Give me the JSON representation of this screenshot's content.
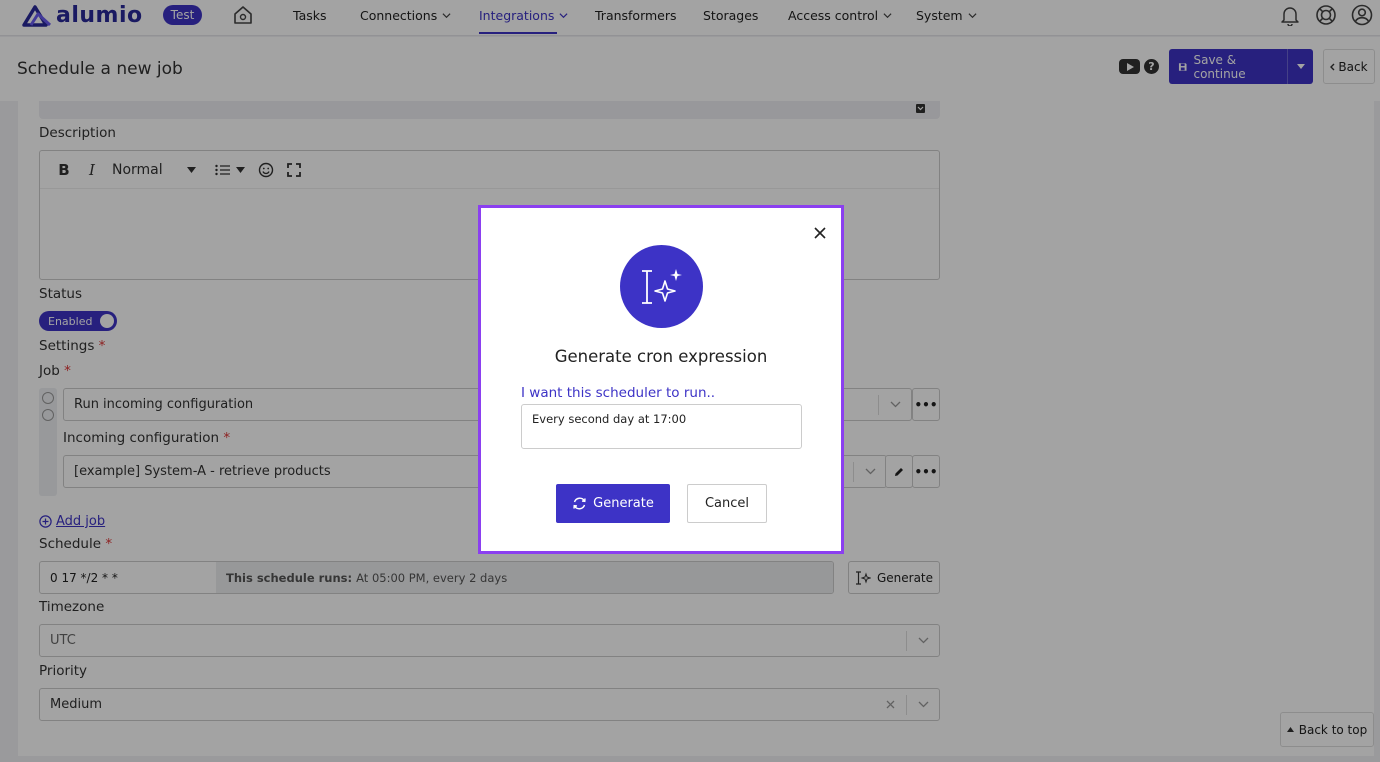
{
  "brand": {
    "name": "alumio",
    "env_badge": "Test"
  },
  "nav": {
    "items": [
      {
        "label": "Tasks"
      },
      {
        "label": "Connections"
      },
      {
        "label": "Integrations"
      },
      {
        "label": "Transformers"
      },
      {
        "label": "Storages"
      },
      {
        "label": "Access control"
      },
      {
        "label": "System"
      }
    ],
    "active": "Integrations"
  },
  "header": {
    "title": "Schedule a new job",
    "save_label": "Save & continue",
    "back_label": "Back",
    "help_glyph": "?"
  },
  "form": {
    "description_label": "Description",
    "editor": {
      "bold": "B",
      "italic": "I",
      "heading_select": "Normal"
    },
    "status_label": "Status",
    "status_toggle": "Enabled",
    "settings_label": "Settings",
    "job_label": "Job",
    "job_value": "Run incoming configuration",
    "incoming_label": "Incoming configuration",
    "incoming_value": "[example] System-A - retrieve products",
    "add_job": "Add job",
    "schedule_label": "Schedule",
    "schedule_expr": "0 17 */2 * *",
    "schedule_desc_prefix": "This schedule runs:",
    "schedule_desc": "At 05:00 PM, every 2 days",
    "generate_label": "Generate",
    "timezone_label": "Timezone",
    "timezone_value": "UTC",
    "priority_label": "Priority",
    "priority_value": "Medium",
    "required_mark": "*",
    "more_glyph": "•••"
  },
  "back_to_top": "Back to top",
  "modal": {
    "title": "Generate cron expression",
    "prompt": "I want this scheduler to run..",
    "input_value": "Every second day at 17:00",
    "generate_label": "Generate",
    "cancel_label": "Cancel"
  },
  "colors": {
    "accent": "#3d33c6",
    "modal_border": "#8b3ff0"
  }
}
